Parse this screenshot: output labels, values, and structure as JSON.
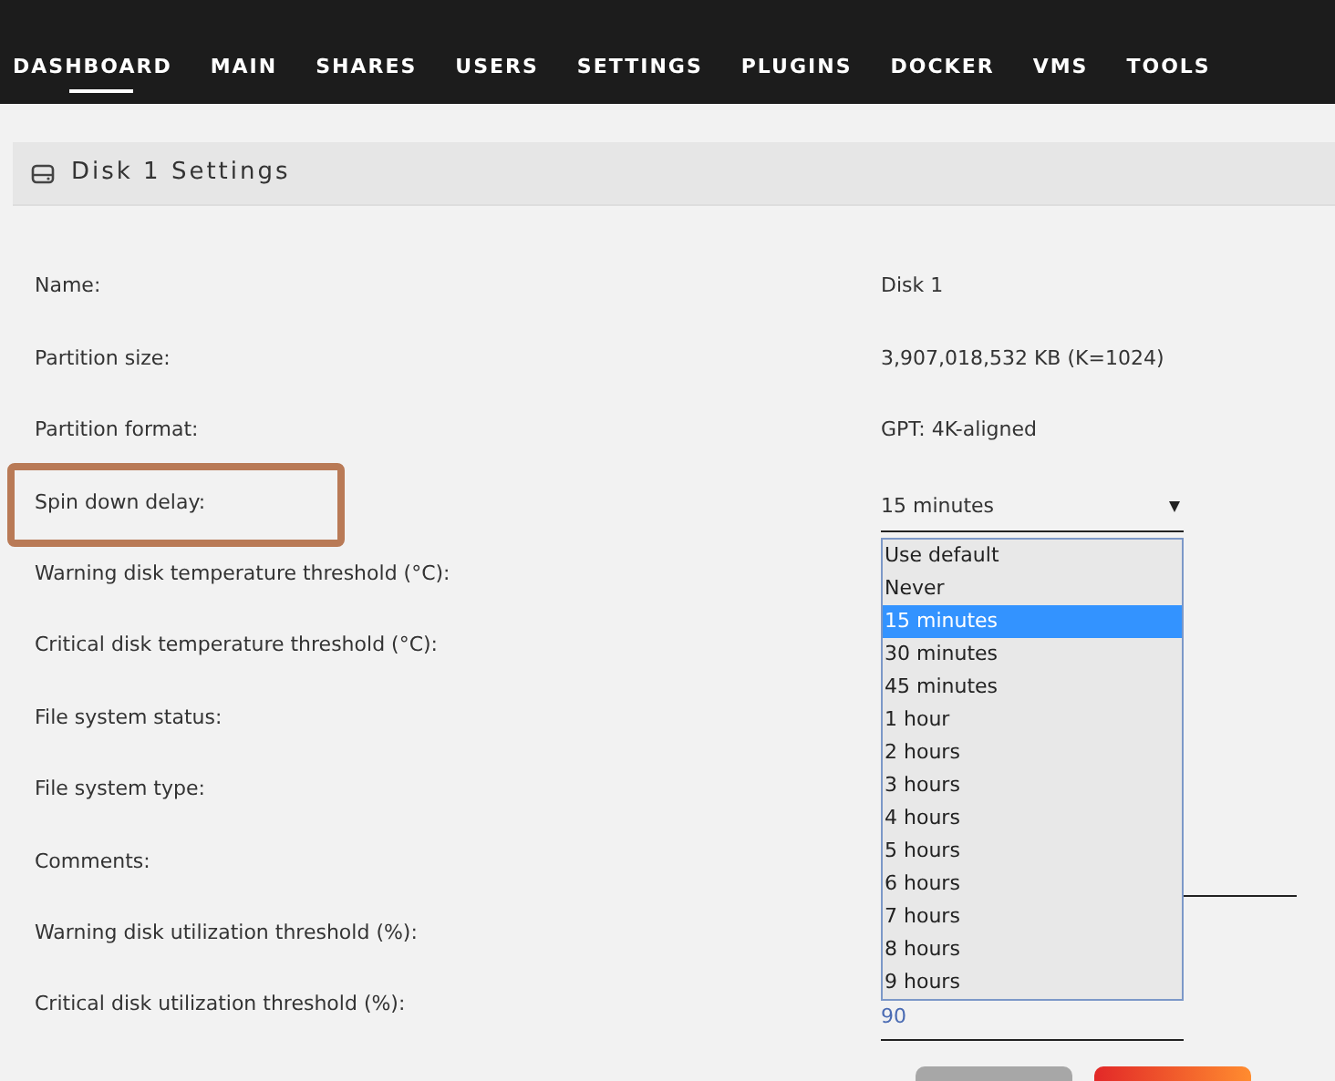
{
  "nav": [
    {
      "label": "DASHBOARD",
      "selected": true
    },
    {
      "label": "MAIN",
      "selected": false
    },
    {
      "label": "SHARES",
      "selected": false
    },
    {
      "label": "USERS",
      "selected": false
    },
    {
      "label": "SETTINGS",
      "selected": false
    },
    {
      "label": "PLUGINS",
      "selected": false
    },
    {
      "label": "DOCKER",
      "selected": false
    },
    {
      "label": "VMS",
      "selected": false
    },
    {
      "label": "TOOLS",
      "selected": false
    }
  ],
  "panel": {
    "title": "Disk 1 Settings"
  },
  "rows": [
    {
      "label": "Name:",
      "kind": "text",
      "value": "Disk 1",
      "highlighted": false
    },
    {
      "label": "Partition size:",
      "kind": "text",
      "value": "3,907,018,532 KB (K=1024)",
      "highlighted": false
    },
    {
      "label": "Partition format:",
      "kind": "text",
      "value": "GPT: 4K-aligned",
      "highlighted": false
    },
    {
      "label": "Spin down delay:",
      "kind": "select",
      "value": "15 minutes",
      "highlighted": true,
      "options": [
        {
          "label": "Use default",
          "selected": false
        },
        {
          "label": "Never",
          "selected": false
        },
        {
          "label": "15 minutes",
          "selected": true
        },
        {
          "label": "30 minutes",
          "selected": false
        },
        {
          "label": "45 minutes",
          "selected": false
        },
        {
          "label": "1 hour",
          "selected": false
        },
        {
          "label": "2 hours",
          "selected": false
        },
        {
          "label": "3 hours",
          "selected": false
        },
        {
          "label": "4 hours",
          "selected": false
        },
        {
          "label": "5 hours",
          "selected": false
        },
        {
          "label": "6 hours",
          "selected": false
        },
        {
          "label": "7 hours",
          "selected": false
        },
        {
          "label": "8 hours",
          "selected": false
        },
        {
          "label": "9 hours",
          "selected": false
        }
      ]
    },
    {
      "label": "Warning disk temperature threshold (°C):",
      "kind": "hidden",
      "highlighted": false
    },
    {
      "label": "Critical disk temperature threshold (°C):",
      "kind": "hidden",
      "highlighted": false
    },
    {
      "label": "File system status:",
      "kind": "hidden",
      "highlighted": false
    },
    {
      "label": "File system type:",
      "kind": "hidden",
      "highlighted": false
    },
    {
      "label": "Comments:",
      "kind": "wide-input",
      "highlighted": false
    },
    {
      "label": "Warning disk utilization threshold (%):",
      "kind": "hidden",
      "highlighted": false
    },
    {
      "label": "Critical disk utilization threshold (%):",
      "kind": "input",
      "value": "90",
      "highlighted": false
    }
  ]
}
